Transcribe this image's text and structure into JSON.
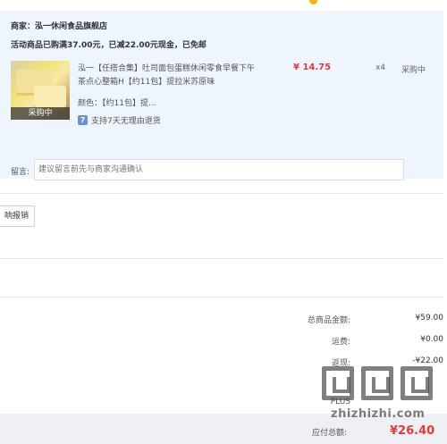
{
  "shop": {
    "name": "商家：泓一休闲食品旗舰店",
    "promo": "活动商品已购满37.00元，已减22.00元现金，已免邮"
  },
  "item": {
    "thumb_tag": "采购中",
    "title": "泓一【任搭合集】吐司面包蛋糕休闲零食早餐下午茶点心整箱H【约11包】提拉米苏原味",
    "price": "¥ 14.75",
    "qty": "x4",
    "status": "采购中",
    "spec": "颜色：【约11包】提...",
    "service_icon": "seven-day-return-icon",
    "service": "支持7天无理由退货"
  },
  "message": {
    "label": "留言:",
    "placeholder": "建议留言前先与商家沟通确认"
  },
  "invoice": {
    "label": "响报销"
  },
  "summary": [
    {
      "key": "总商品金额:",
      "value": "¥59.00"
    },
    {
      "key": "运费:",
      "value": "¥0.00"
    },
    {
      "key": "返现:",
      "value": "-¥22.00"
    },
    {
      "key": "",
      "value": ""
    },
    {
      "key": "PLUS",
      "value": ""
    }
  ],
  "total": {
    "key": "应付总额:",
    "value": "¥26.40"
  },
  "watermark": {
    "site": "zhizhizhi.com"
  },
  "colors": {
    "accent_red": "#e4393c",
    "panel_bg": "#eef5fd"
  }
}
